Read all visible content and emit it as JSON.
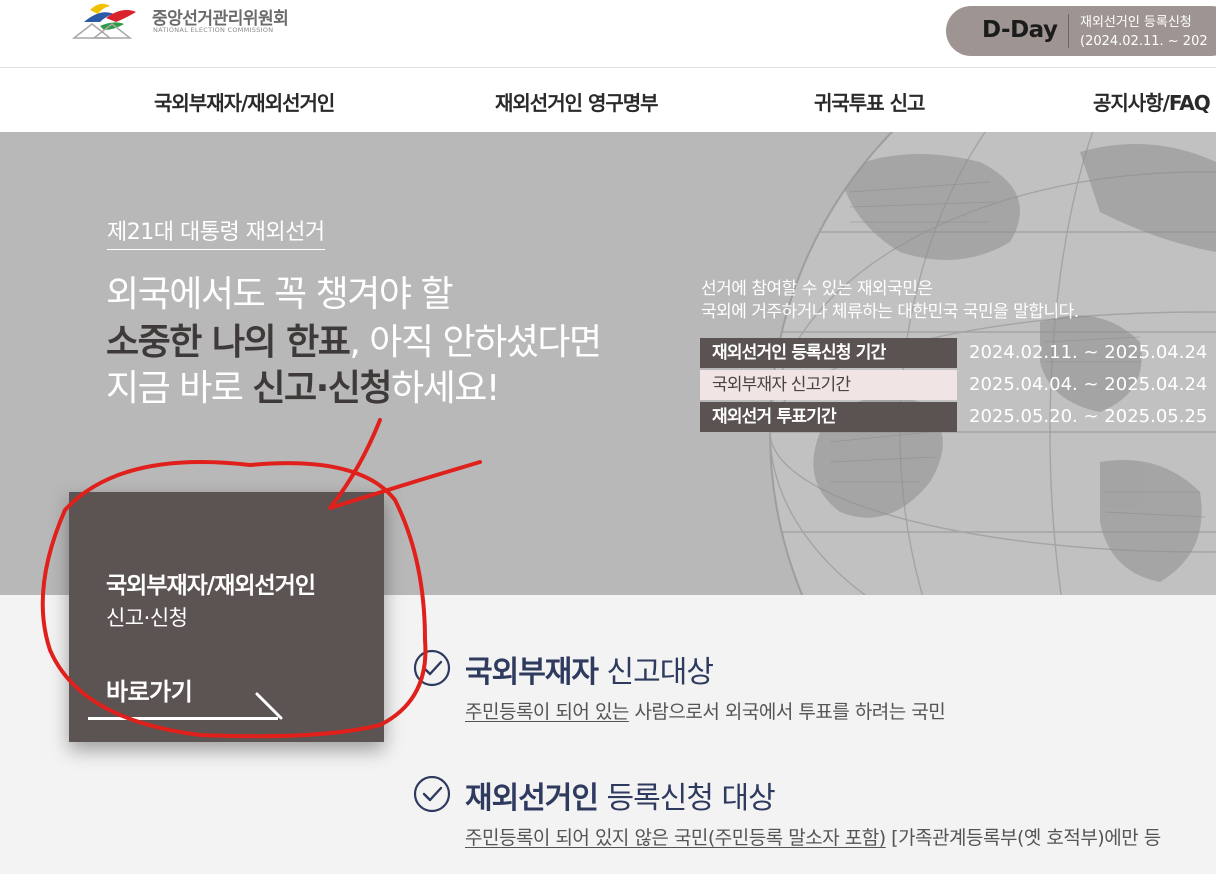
{
  "header": {
    "logo_name": "중앙선거관리위원회",
    "logo_sub": "NATIONAL ELECTION COMMISSION",
    "dday_label": "D-Day",
    "dday_line1": "재외선거인 등록신청",
    "dday_line2": "(2024.02.11. ~ 202"
  },
  "nav": {
    "items": [
      {
        "label": "국외부재자/재외선거인"
      },
      {
        "label": "재외선거인 영구명부"
      },
      {
        "label": "귀국투표 신고"
      },
      {
        "label": "공지사항/FAQ"
      }
    ]
  },
  "hero": {
    "election_tag": "제21대 대통령 재외선거",
    "line1": "외국에서도 꼭 챙겨야 할",
    "line2_bold": "소중한 나의 한표",
    "line2_rest": ", 아직 안하셨다면",
    "line3_pre": "지금 바로 ",
    "line3_bold": "신고·신청",
    "line3_post": "하세요!",
    "desc_line1": "선거에 참여할 수 있는 재외국민은",
    "desc_line2": "국외에 거주하거나 체류하는 대한민국 국민을 말합니다.",
    "periods": [
      {
        "label": "재외선거인 등록신청 기간",
        "date": "2024.02.11. ~ 2025.04.24"
      },
      {
        "label": "국외부재자 신고기간",
        "date": "2025.04.04. ~ 2025.04.24"
      },
      {
        "label": "재외선거 투표기간",
        "date": "2025.05.20. ~ 2025.05.25"
      }
    ]
  },
  "card": {
    "title": "국외부재자/재외선거인",
    "sub": "신고·신청",
    "go": "바로가기"
  },
  "targets": [
    {
      "title_bold": "국외부재자",
      "title_rest": " 신고대상",
      "desc_link": "주민등록이 되어 있는",
      "desc_rest": " 사람으로서 외국에서 투표를 하려는 국민"
    },
    {
      "title_bold": "재외선거인",
      "title_rest": " 등록신청 대상",
      "desc_link": "주민등록이 되어 있지 않은 국민(주민등록 말소자 포함)",
      "desc_rest": " [가족관계등록부(옛 호적부)에만 등"
    }
  ],
  "colors": {
    "hero_bg": "#b9b8b8",
    "card_bg": "#5b5453",
    "dday_bg": "#9e9592",
    "title_navy": "#2e3a5e",
    "annotation_red": "#e0201b"
  },
  "icons": [
    "logo-emblem-icon",
    "globe-illustration",
    "check-circle-icon",
    "arrow-icon"
  ]
}
